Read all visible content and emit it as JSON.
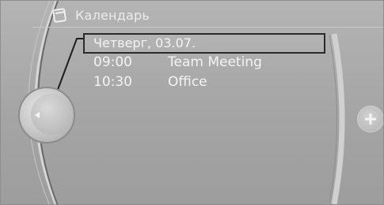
{
  "header": {
    "title": "Календарь",
    "icon": "calendar-icon"
  },
  "calendar": {
    "selected_date": "Четверг, 03.07.",
    "events": [
      {
        "time": "09:00",
        "title": "Team Meeting"
      },
      {
        "time": "10:30",
        "title": "Office"
      }
    ]
  },
  "controls": {
    "left_icon": "back-arrow-icon",
    "right_icon": "plus-icon"
  },
  "colors": {
    "background": "#a8a8a8",
    "text": "#f4f4f4",
    "focus_frame": "#2a2a2a"
  }
}
